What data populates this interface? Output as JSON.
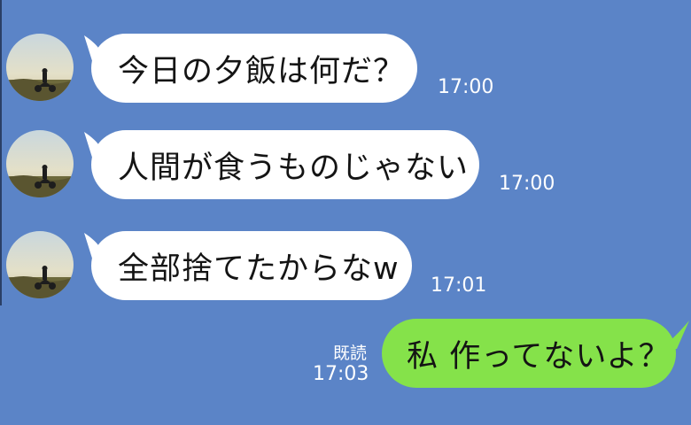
{
  "messages": [
    {
      "sender": "other",
      "text": "今日の夕飯は何だ？",
      "time": "17:00"
    },
    {
      "sender": "other",
      "text": "人間が食うものじゃない",
      "time": "17:00"
    },
    {
      "sender": "other",
      "text": "全部捨てたからなw",
      "time": "17:01"
    },
    {
      "sender": "self",
      "text": "私 作ってないよ？",
      "time": "17:03",
      "read_label": "既読"
    }
  ],
  "colors": {
    "background": "#5b84c7",
    "incoming_bubble": "#ffffff",
    "outgoing_bubble": "#85e24a"
  },
  "avatar_icon": "motorcycle-rider-avatar-icon"
}
